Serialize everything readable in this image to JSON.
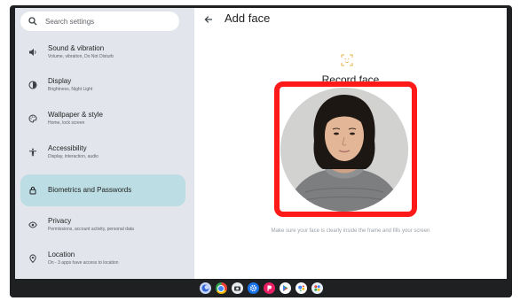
{
  "search": {
    "placeholder": "Search settings"
  },
  "sidebar": {
    "items": [
      {
        "title": "Sound & vibration",
        "subtitle": "Volume, vibration, Do Not Disturb",
        "icon": "speaker-icon"
      },
      {
        "title": "Display",
        "subtitle": "Brightness, Night Light",
        "icon": "display-icon"
      },
      {
        "title": "Wallpaper & style",
        "subtitle": "Home, lock screen",
        "icon": "palette-icon"
      },
      {
        "title": "Accessibility",
        "subtitle": "Display, interaction, audio",
        "icon": "accessibility-icon"
      },
      {
        "title": "Biometrics and Passwords",
        "subtitle": "",
        "icon": "lock-icon",
        "selected": true
      },
      {
        "title": "Privacy",
        "subtitle": "Permissions, account activity, personal data",
        "icon": "privacy-eye-icon"
      },
      {
        "title": "Location",
        "subtitle": "On - 3 apps have access to location",
        "icon": "location-pin-icon"
      }
    ]
  },
  "main": {
    "title": "Add face",
    "heading": "Record face",
    "hint": "Make sure your face is clearly inside the frame and fills your screen"
  },
  "colors": {
    "highlight": "#ff1a1a",
    "selected_item": "#bcdde3",
    "sidebar_bg": "#e2e6ec"
  },
  "taskbar": {
    "apps": [
      "launcher-icon",
      "chrome-icon",
      "camera-icon",
      "settings-icon",
      "photos-icon",
      "play-store-icon",
      "assistant-icon",
      "app-grid-icon"
    ]
  }
}
